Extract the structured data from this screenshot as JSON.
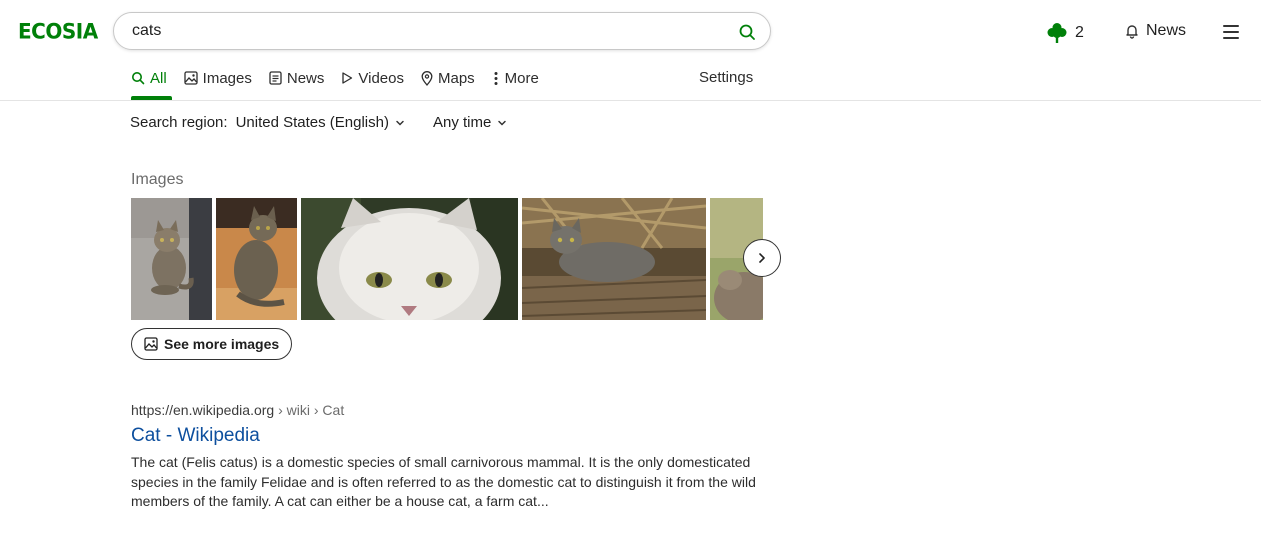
{
  "header": {
    "logo": "ECOSIA",
    "search_value": "cats",
    "tree_count": "2",
    "news_label": "News"
  },
  "tabs": [
    {
      "label": "All",
      "icon": "search-icon",
      "active": true
    },
    {
      "label": "Images",
      "icon": "image-icon"
    },
    {
      "label": "News",
      "icon": "news-icon"
    },
    {
      "label": "Videos",
      "icon": "play-icon"
    },
    {
      "label": "Maps",
      "icon": "map-pin-icon"
    },
    {
      "label": "More",
      "icon": "more-vertical-icon"
    }
  ],
  "settings_label": "Settings",
  "filters": {
    "region_label": "Search region:",
    "region_value": "United States (English)",
    "time_value": "Any time"
  },
  "images_section": {
    "heading": "Images",
    "see_more_label": "See more images"
  },
  "result": {
    "url": "https://en.wikipedia.org",
    "breadcrumbs": "› wiki › Cat",
    "title": "Cat - Wikipedia",
    "snippet": "The cat (Felis catus) is a domestic species of small carnivorous mammal. It is the only domesticated species in the family Felidae and is often referred to as the domestic cat to distinguish it from the wild members of the family. A cat can either be a house cat, a farm cat..."
  },
  "colors": {
    "brand_green": "#008009",
    "link_blue": "#0d4f9e"
  }
}
